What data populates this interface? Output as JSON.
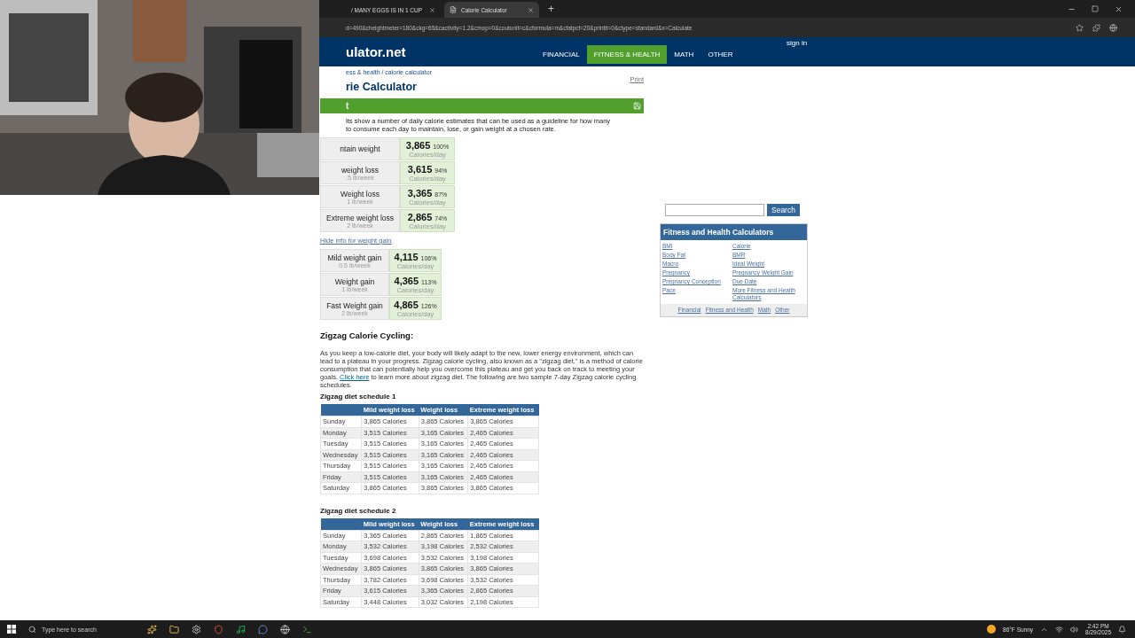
{
  "browser": {
    "tabs": [
      {
        "title": "/ MANY EGGS IS IN 1 CUP",
        "selected": false
      },
      {
        "title": "Calorie Calculator",
        "selected": true
      }
    ],
    "new_tab": "+",
    "url": "d=490&cheightmeter=180&ckg=65&cactivity=1.2&cmop=0&coutunit=c&cformula=m&cfatpct=20&printit=0&ctype=standard&x=Calculate"
  },
  "webcam": {
    "kind": "picture"
  },
  "site": {
    "logo": "ulator.net",
    "sign_in": "sign in",
    "nav": [
      {
        "label": "FINANCIAL",
        "selected": false
      },
      {
        "label": "FITNESS & HEALTH",
        "selected": true
      },
      {
        "label": "MATH",
        "selected": false
      },
      {
        "label": "OTHER",
        "selected": false
      }
    ]
  },
  "breadcrumb": "ess & health / calorie calculator",
  "print": "Print",
  "title": "rie Calculator",
  "result_bar": {
    "title": "t"
  },
  "intro_lines": [
    "lts show a number of daily calorie estimates that can be used as a guideline for how many",
    "to consume each day to maintain, lose, or gain weight at a chosen rate."
  ],
  "loss_results": [
    {
      "label": "ntain weight",
      "value": "3,865",
      "percent": "100%",
      "unit": "Calories/day"
    },
    {
      "label": "weight loss",
      "rate": ".5 lb/week",
      "value": "3,615",
      "percent": "94%",
      "unit": "Calories/day"
    },
    {
      "label": "Weight loss",
      "rate": "1 lb/week",
      "value": "3,365",
      "percent": "87%",
      "unit": "Calories/day"
    },
    {
      "label": "Extreme weight loss",
      "rate": "2 lb/week",
      "value": "2,865",
      "percent": "74%",
      "unit": "Calories/day"
    }
  ],
  "gain_toggle": "Hide info for weight gain",
  "gain_results": [
    {
      "label": "Mild weight gain",
      "rate": "0.5 lb/week",
      "value": "4,115",
      "percent": "106%",
      "unit": "Calories/day"
    },
    {
      "label": "Weight gain",
      "rate": "1 lb/week",
      "value": "4,365",
      "percent": "113%",
      "unit": "Calories/day"
    },
    {
      "label": "Fast Weight gain",
      "rate": "2 lb/week",
      "value": "4,865",
      "percent": "126%",
      "unit": "Calories/day"
    }
  ],
  "zigzag": {
    "heading": "Zigzag Calorie Cycling:",
    "text_before": "As you keep a low-calorie diet, your body will likely adapt to the new, lower energy environment, which can lead to a plateau in your progress. Zigzag calorie cycling, also known as a \"zigzag diet,\" is a method of calorie consumption that can potentially help you overcome this plateau and get you back on track to meeting your goals. ",
    "link": "Click here",
    "text_after": " to learn more about zigzag diet. The following are two sample 7-day Zigzag calorie cycling schedules."
  },
  "schedules": [
    {
      "title": "Zigzag diet schedule 1",
      "columns": [
        "",
        "Mild weight loss",
        "Weight loss",
        "Extreme weight loss"
      ],
      "rows": [
        [
          "Sunday",
          "3,865 Calories",
          "3,865 Calories",
          "3,865 Calories"
        ],
        [
          "Monday",
          "3,515 Calories",
          "3,165 Calories",
          "2,465 Calories"
        ],
        [
          "Tuesday",
          "3,515 Calories",
          "3,165 Calories",
          "2,465 Calories"
        ],
        [
          "Wednesday",
          "3,515 Calories",
          "3,165 Calories",
          "2,465 Calories"
        ],
        [
          "Thursday",
          "3,515 Calories",
          "3,165 Calories",
          "2,465 Calories"
        ],
        [
          "Friday",
          "3,515 Calories",
          "3,165 Calories",
          "2,465 Calories"
        ],
        [
          "Saturday",
          "3,865 Calories",
          "3,865 Calories",
          "3,865 Calories"
        ]
      ]
    },
    {
      "title": "Zigzag diet schedule 2",
      "columns": [
        "",
        "Mild weight loss",
        "Weight loss",
        "Extreme weight loss"
      ],
      "rows": [
        [
          "Sunday",
          "3,365 Calories",
          "2,865 Calories",
          "1,865 Calories"
        ],
        [
          "Monday",
          "3,532 Calories",
          "3,198 Calories",
          "2,532 Calories"
        ],
        [
          "Tuesday",
          "3,698 Calories",
          "3,532 Calories",
          "3,198 Calories"
        ],
        [
          "Wednesday",
          "3,865 Calories",
          "3,865 Calories",
          "3,865 Calories"
        ],
        [
          "Thursday",
          "3,782 Calories",
          "3,698 Calories",
          "3,532 Calories"
        ],
        [
          "Friday",
          "3,615 Calories",
          "3,365 Calories",
          "2,865 Calories"
        ],
        [
          "Saturday",
          "3,448 Calories",
          "3,032 Calories",
          "2,198 Calories"
        ]
      ]
    }
  ],
  "sidebar": {
    "search_button": "Search",
    "panel_title": "Fitness and Health Calculators",
    "links": [
      "BMI",
      "Calorie",
      "Body Fat",
      "BMR",
      "Macro",
      "Ideal Weight",
      "Pregnancy",
      "Pregnancy Weight Gain",
      "Pregnancy Conception",
      "Due Date",
      "Pace",
      "More Fitness and Health Calculators"
    ],
    "footer_links": [
      "Financial",
      "Fitness and Health",
      "Math",
      "Other"
    ]
  },
  "taskbar": {
    "search_placeholder": "Type here to search",
    "weather": "86°F Sunny",
    "time": "2:42 PM",
    "date": "8/29/2025"
  }
}
